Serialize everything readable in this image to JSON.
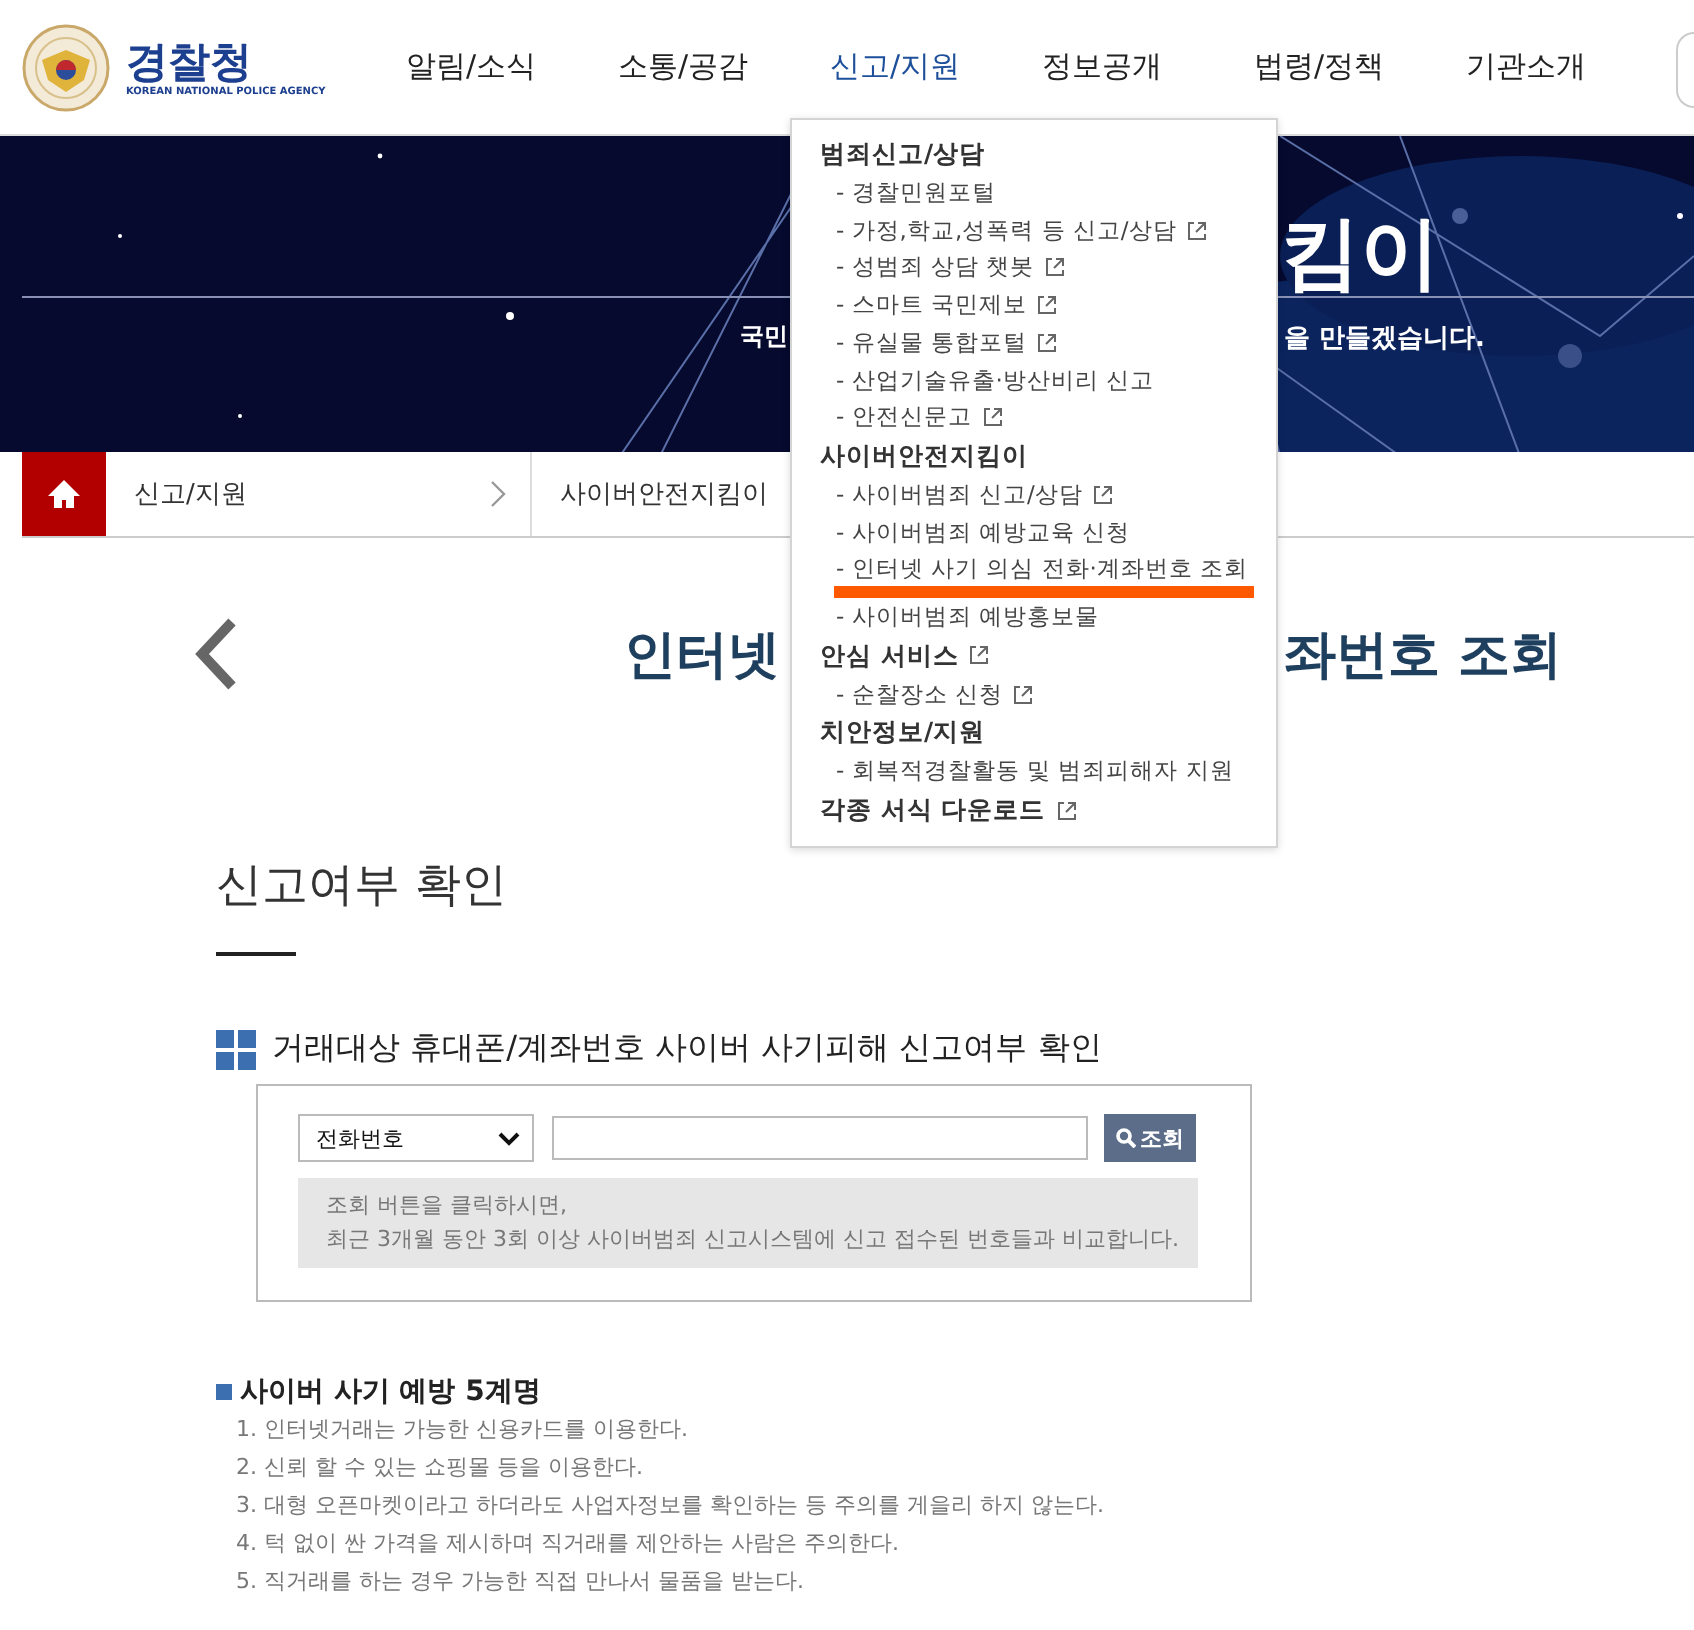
{
  "logo": {
    "name": "경찰청",
    "subtitle": "KOREAN NATIONAL POLICE AGENCY"
  },
  "nav": [
    {
      "label": "알림/소식",
      "selected": false
    },
    {
      "label": "소통/공감",
      "selected": false
    },
    {
      "label": "신고/지원",
      "selected": true
    },
    {
      "label": "정보공개",
      "selected": false
    },
    {
      "label": "법령/정책",
      "selected": false
    },
    {
      "label": "기관소개",
      "selected": false
    }
  ],
  "banner": {
    "title_visible_part": "킴이",
    "subtitle_left_part": "국민",
    "subtitle_right_part": "을 만들겠습니다."
  },
  "breadcrumb": [
    {
      "label": "신고/지원"
    },
    {
      "label": "사이버안전지킴이"
    }
  ],
  "page_title": {
    "left_part": "인터넷",
    "right_part": "좌번호 조회"
  },
  "dropdown": [
    {
      "title": "범죄신고/상담",
      "external": false,
      "items": [
        {
          "label": "- 경찰민원포털",
          "external": false,
          "highlighted": false
        },
        {
          "label": "- 가정,학교,성폭력 등 신고/상담",
          "external": true,
          "highlighted": false
        },
        {
          "label": "- 성범죄 상담 챗봇",
          "external": true,
          "highlighted": false
        },
        {
          "label": "- 스마트 국민제보",
          "external": true,
          "highlighted": false
        },
        {
          "label": "- 유실물 통합포털",
          "external": true,
          "highlighted": false
        },
        {
          "label": "- 산업기술유출·방산비리 신고",
          "external": false,
          "highlighted": false
        },
        {
          "label": "- 안전신문고",
          "external": true,
          "highlighted": false
        }
      ]
    },
    {
      "title": "사이버안전지킴이",
      "external": false,
      "items": [
        {
          "label": "- 사이버범죄 신고/상담",
          "external": true,
          "highlighted": false
        },
        {
          "label": "- 사이버범죄 예방교육 신청",
          "external": false,
          "highlighted": false
        },
        {
          "label": "- 인터넷 사기 의심 전화·계좌번호 조회",
          "external": false,
          "highlighted": true
        },
        {
          "label": "- 사이버범죄 예방홍보물",
          "external": false,
          "highlighted": false
        }
      ]
    },
    {
      "title": "안심 서비스",
      "external": true,
      "items": [
        {
          "label": "- 순찰장소 신청",
          "external": true,
          "highlighted": false
        }
      ]
    },
    {
      "title": "치안정보/지원",
      "external": false,
      "items": [
        {
          "label": "- 회복적경찰활동 및 범죄피해자 지원",
          "external": false,
          "highlighted": false
        }
      ]
    },
    {
      "title": "각종 서식 다운로드",
      "external": true
    }
  ],
  "section": {
    "title": "신고여부 확인",
    "check_title": "거래대상 휴대폰/계좌번호 사이버 사기피해 신고여부 확인",
    "select_value": "전화번호",
    "button": "조회",
    "info_lines": [
      "조회 버튼을 클릭하시면,",
      "최근 3개월 동안 3회 이상 사이버범죄 신고시스템에 신고 접수된 번호들과 비교합니다."
    ]
  },
  "tips": {
    "title": "사이버 사기 예방 5계명",
    "items": [
      "1. 인터넷거래는 가능한 신용카드를 이용한다.",
      "2. 신뢰 할 수 있는 쇼핑몰 등을 이용한다.",
      "3. 대형 오픈마켓이라고 하더라도 사업자정보를 확인하는 등 주의를 게을리 하지 않는다.",
      "4. 턱 없이 싼 가격을 제시하며 직거래를 제안하는 사람은 주의한다.",
      "5. 직거래를 하는 경우 가능한 직접 만나서 물품을 받는다."
    ]
  }
}
